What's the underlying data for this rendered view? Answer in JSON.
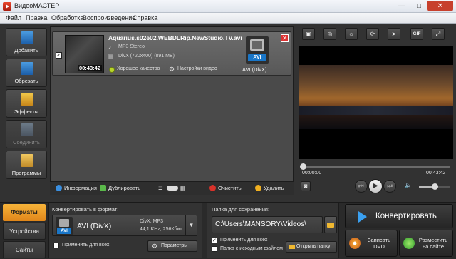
{
  "window": {
    "title": "ВидеоМАСТЕР",
    "minimize": "—",
    "maximize": "□",
    "close": "✕"
  },
  "menu": [
    "Файл",
    "Правка",
    "Обработка",
    "Воспроизведение",
    "Справка"
  ],
  "tools": [
    {
      "label": "Добавить",
      "icon": "add-film-icon",
      "enabled": true
    },
    {
      "label": "Обрезать",
      "icon": "cut-film-icon",
      "enabled": true
    },
    {
      "label": "Эффекты",
      "icon": "effects-icon",
      "enabled": true
    },
    {
      "label": "Соединить",
      "icon": "join-film-icon",
      "enabled": false
    },
    {
      "label": "Программы",
      "icon": "programs-icon",
      "enabled": true
    }
  ],
  "file": {
    "name": "Aquarius.s02e02.WEBDLRip.NewStudio.TV.avi",
    "duration": "00:43:42",
    "audio": "MP3 Stereo",
    "video": "DivX (720x400) (891 MB)",
    "quality": "Хорошее качество",
    "settings": "Настройки видео",
    "format_tag": "AVI",
    "format_name": "AVI (DivX)",
    "checked": true
  },
  "list_toolbar": {
    "info": "Информация",
    "duplicate": "Дублировать",
    "clear": "Очистить",
    "delete": "Удалить"
  },
  "preview_tools": [
    "crop-icon",
    "stabilize-icon",
    "brightness-icon",
    "rotate-icon",
    "speed-icon",
    "gif-icon",
    "fullscreen-icon"
  ],
  "preview_tool_gif_label": "GIF",
  "player": {
    "time_current": "00:00:00",
    "time_total": "00:43:42",
    "progress": 0.0,
    "volume": 0.5
  },
  "tabs": [
    "Форматы",
    "Устройства",
    "Сайты"
  ],
  "convert": {
    "label": "Конвертировать в формат:",
    "format_tag": "AVI",
    "format": "AVI (DivX)",
    "spec1": "DivX, MP3",
    "spec2": "44,1 KHz, 256Кбит",
    "apply_all": "Применить для всех",
    "params": "Параметры"
  },
  "save": {
    "label": "Папка для сохранения:",
    "path": "C:\\Users\\MANSORY\\Videos\\",
    "apply_all": "Применить для всех",
    "apply_all_checked": true,
    "source_folder": "Папка с исходным файлом",
    "source_folder_checked": false,
    "open_folder": "Открыть папку"
  },
  "actions": {
    "convert": "Конвертировать",
    "burn_dvd_line1": "Записать",
    "burn_dvd_line2": "DVD",
    "publish_line1": "Разместить",
    "publish_line2": "на сайте"
  },
  "colors": {
    "accent_orange": "#f0a030",
    "convert_blue": "#3aa0f0",
    "format_tag_blue": "#1976c8"
  }
}
